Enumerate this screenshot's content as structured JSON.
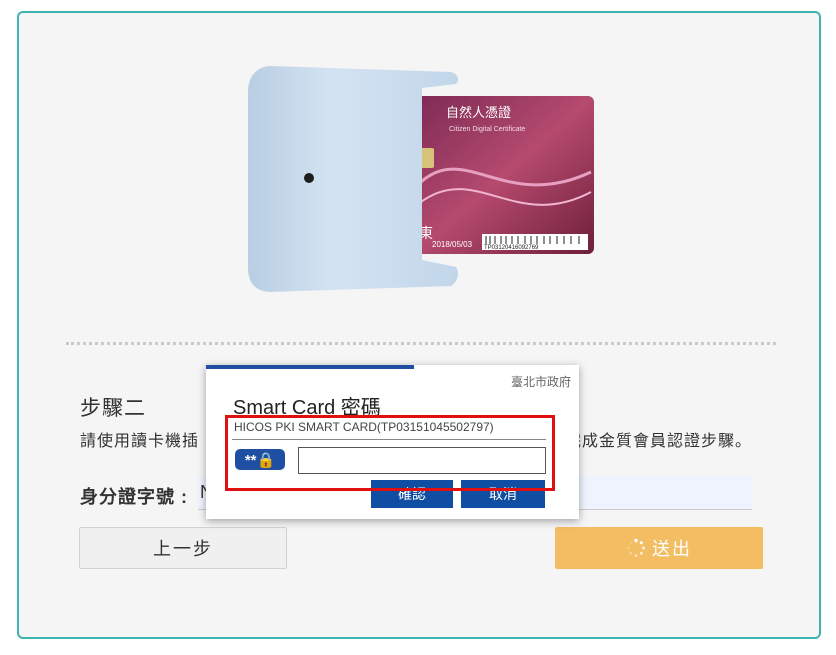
{
  "illustration": {
    "card_title": "自然人憑證",
    "card_subtitle": "Citizen Digital Certificate",
    "card_date": "2018/05/03",
    "card_serial": "TP03120416092769",
    "card_name_char": "東"
  },
  "step": {
    "title": "步驟二",
    "desc_left": "請使用讀卡機插",
    "desc_right": "完成金質會員認證步驟。"
  },
  "id_field": {
    "label": "身分證字號 :",
    "value": "N"
  },
  "buttons": {
    "prev": "上一步",
    "submit": "送出"
  },
  "dialog": {
    "org": "臺北市政府",
    "title": "Smart Card 密碼",
    "card_info": "HICOS PKI SMART CARD(TP03151045502797)",
    "pin_badge": "**🔒",
    "ok": "確認",
    "cancel": "取消"
  },
  "colors": {
    "panel_border": "#3fb3b0",
    "submit_bg": "#f2bd63",
    "dialog_blue": "#0f4ea2",
    "highlight": "#e01010"
  }
}
